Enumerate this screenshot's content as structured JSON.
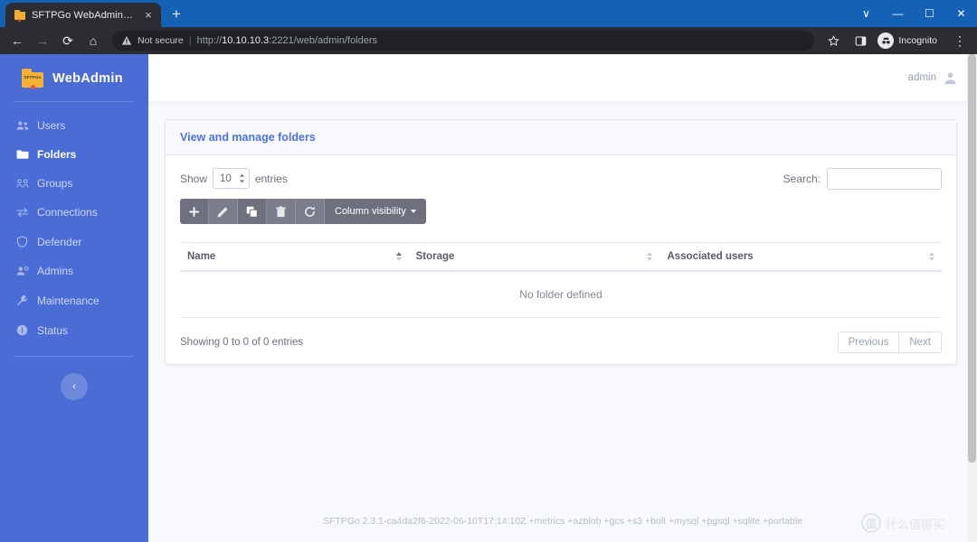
{
  "browser": {
    "tab": {
      "title": "SFTPGo WebAdmin - Folders",
      "favicon": "folder-icon",
      "close_label": "×"
    },
    "new_tab_label": "+",
    "window_controls": {
      "minimize_tabs": "∨",
      "minimize": "—",
      "maximize": "☐",
      "close": "✕"
    },
    "nav": {
      "back": "←",
      "forward": "→",
      "reload": "⟳",
      "home": "⌂"
    },
    "omnibox": {
      "security_label": "Not secure",
      "separator": "|",
      "url_prefix": "http://",
      "url_host": "10.10.10.3",
      "url_rest": ":2221/web/admin/folders",
      "bookmark_icon": "star-icon",
      "sidepanel_icon": "side-panel-icon",
      "incognito_label": "Incognito",
      "menu_icon": "kebab-menu-icon"
    }
  },
  "sidebar": {
    "brand": {
      "logo_text": "SFTPGo",
      "name": "WebAdmin"
    },
    "items": [
      {
        "label": "Users",
        "icon": "users-icon",
        "active": false
      },
      {
        "label": "Folders",
        "icon": "folder-icon",
        "active": true
      },
      {
        "label": "Groups",
        "icon": "groups-icon",
        "active": false
      },
      {
        "label": "Connections",
        "icon": "exchange-icon",
        "active": false
      },
      {
        "label": "Defender",
        "icon": "shield-icon",
        "active": false
      },
      {
        "label": "Admins",
        "icon": "user-gear-icon",
        "active": false
      },
      {
        "label": "Maintenance",
        "icon": "wrench-icon",
        "active": false
      },
      {
        "label": "Status",
        "icon": "info-icon",
        "active": false
      }
    ],
    "collapse_label": "‹"
  },
  "topbar": {
    "user": "admin",
    "avatar_icon": "user-avatar-icon"
  },
  "card": {
    "title": "View and manage folders",
    "datatable": {
      "length_prefix": "Show",
      "length_value": "10",
      "length_suffix": "entries",
      "search_label": "Search:",
      "search_value": "",
      "search_placeholder": "",
      "buttons": [
        {
          "name": "add-button",
          "icon": "plus-icon",
          "label": ""
        },
        {
          "name": "edit-button",
          "icon": "pencil-icon",
          "label": ""
        },
        {
          "name": "clone-button",
          "icon": "copy-icon",
          "label": ""
        },
        {
          "name": "delete-button",
          "icon": "trash-icon",
          "label": ""
        },
        {
          "name": "refresh-button",
          "icon": "refresh-icon",
          "label": ""
        }
      ],
      "column_visibility_label": "Column visibility",
      "columns": [
        {
          "label": "Name",
          "sort": "asc"
        },
        {
          "label": "Storage",
          "sort": "none"
        },
        {
          "label": "Associated users",
          "sort": "none"
        }
      ],
      "empty_message": "No folder defined",
      "info": "Showing 0 to 0 of 0 entries",
      "previous_label": "Previous",
      "next_label": "Next"
    }
  },
  "footer": {
    "version": "SFTPGo 2.3.1-ca4da2f6-2022-06-10T17:14:10Z +metrics +azblob +gcs +s3 +bolt +mysql +pgsql +sqlite +portable"
  },
  "watermark": {
    "mark": "值",
    "text": "什么值得买"
  },
  "colors": {
    "sidebar": "#4a6cd4",
    "accent": "#4e73df",
    "button_group": "#6e707e",
    "content_bg": "#f8f9fc",
    "chrome_tabstrip": "#1461b5"
  }
}
